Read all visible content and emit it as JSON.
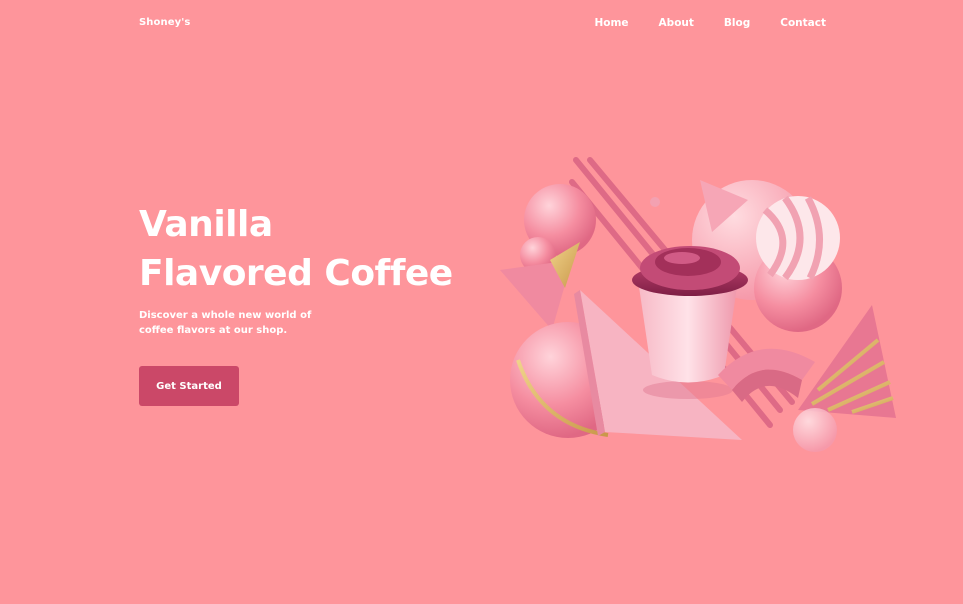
{
  "nav": {
    "brand": "Shoney's",
    "links": [
      "Home",
      "About",
      "Blog",
      "Contact"
    ]
  },
  "hero": {
    "title_line1": "Vanilla",
    "title_line2": "Flavored Coffee",
    "subtitle": "Discover a whole new world of coffee flavors at our shop.",
    "cta_label": "Get Started"
  },
  "colors": {
    "background": "#fe959b",
    "button": "#cb4868",
    "text": "#ffffff"
  },
  "icons": [
    "coffee-cup-illustration"
  ]
}
